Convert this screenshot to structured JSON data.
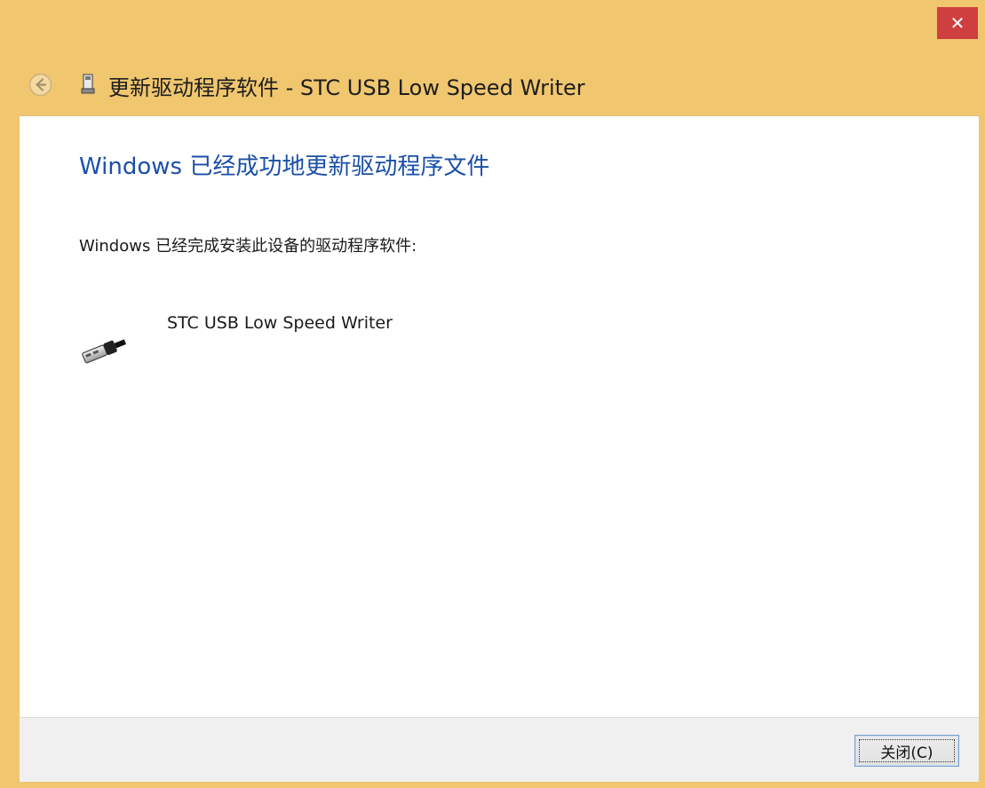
{
  "window": {
    "close_glyph": "✕",
    "title_bar_color": "#f0c66f",
    "close_color": "#cf3f3f"
  },
  "header": {
    "title": "更新驱动程序软件 - STC USB Low Speed Writer",
    "back_icon": "back-arrow-icon",
    "device_icon": "usb-device-icon"
  },
  "content": {
    "heading": "Windows 已经成功地更新驱动程序文件",
    "heading_color": "#1a4fa8",
    "description": "Windows 已经完成安装此设备的驱动程序软件:",
    "device": {
      "name": "STC USB Low Speed Writer",
      "icon": "usb-plug-icon"
    }
  },
  "footer": {
    "close_label": "关闭(C)"
  }
}
